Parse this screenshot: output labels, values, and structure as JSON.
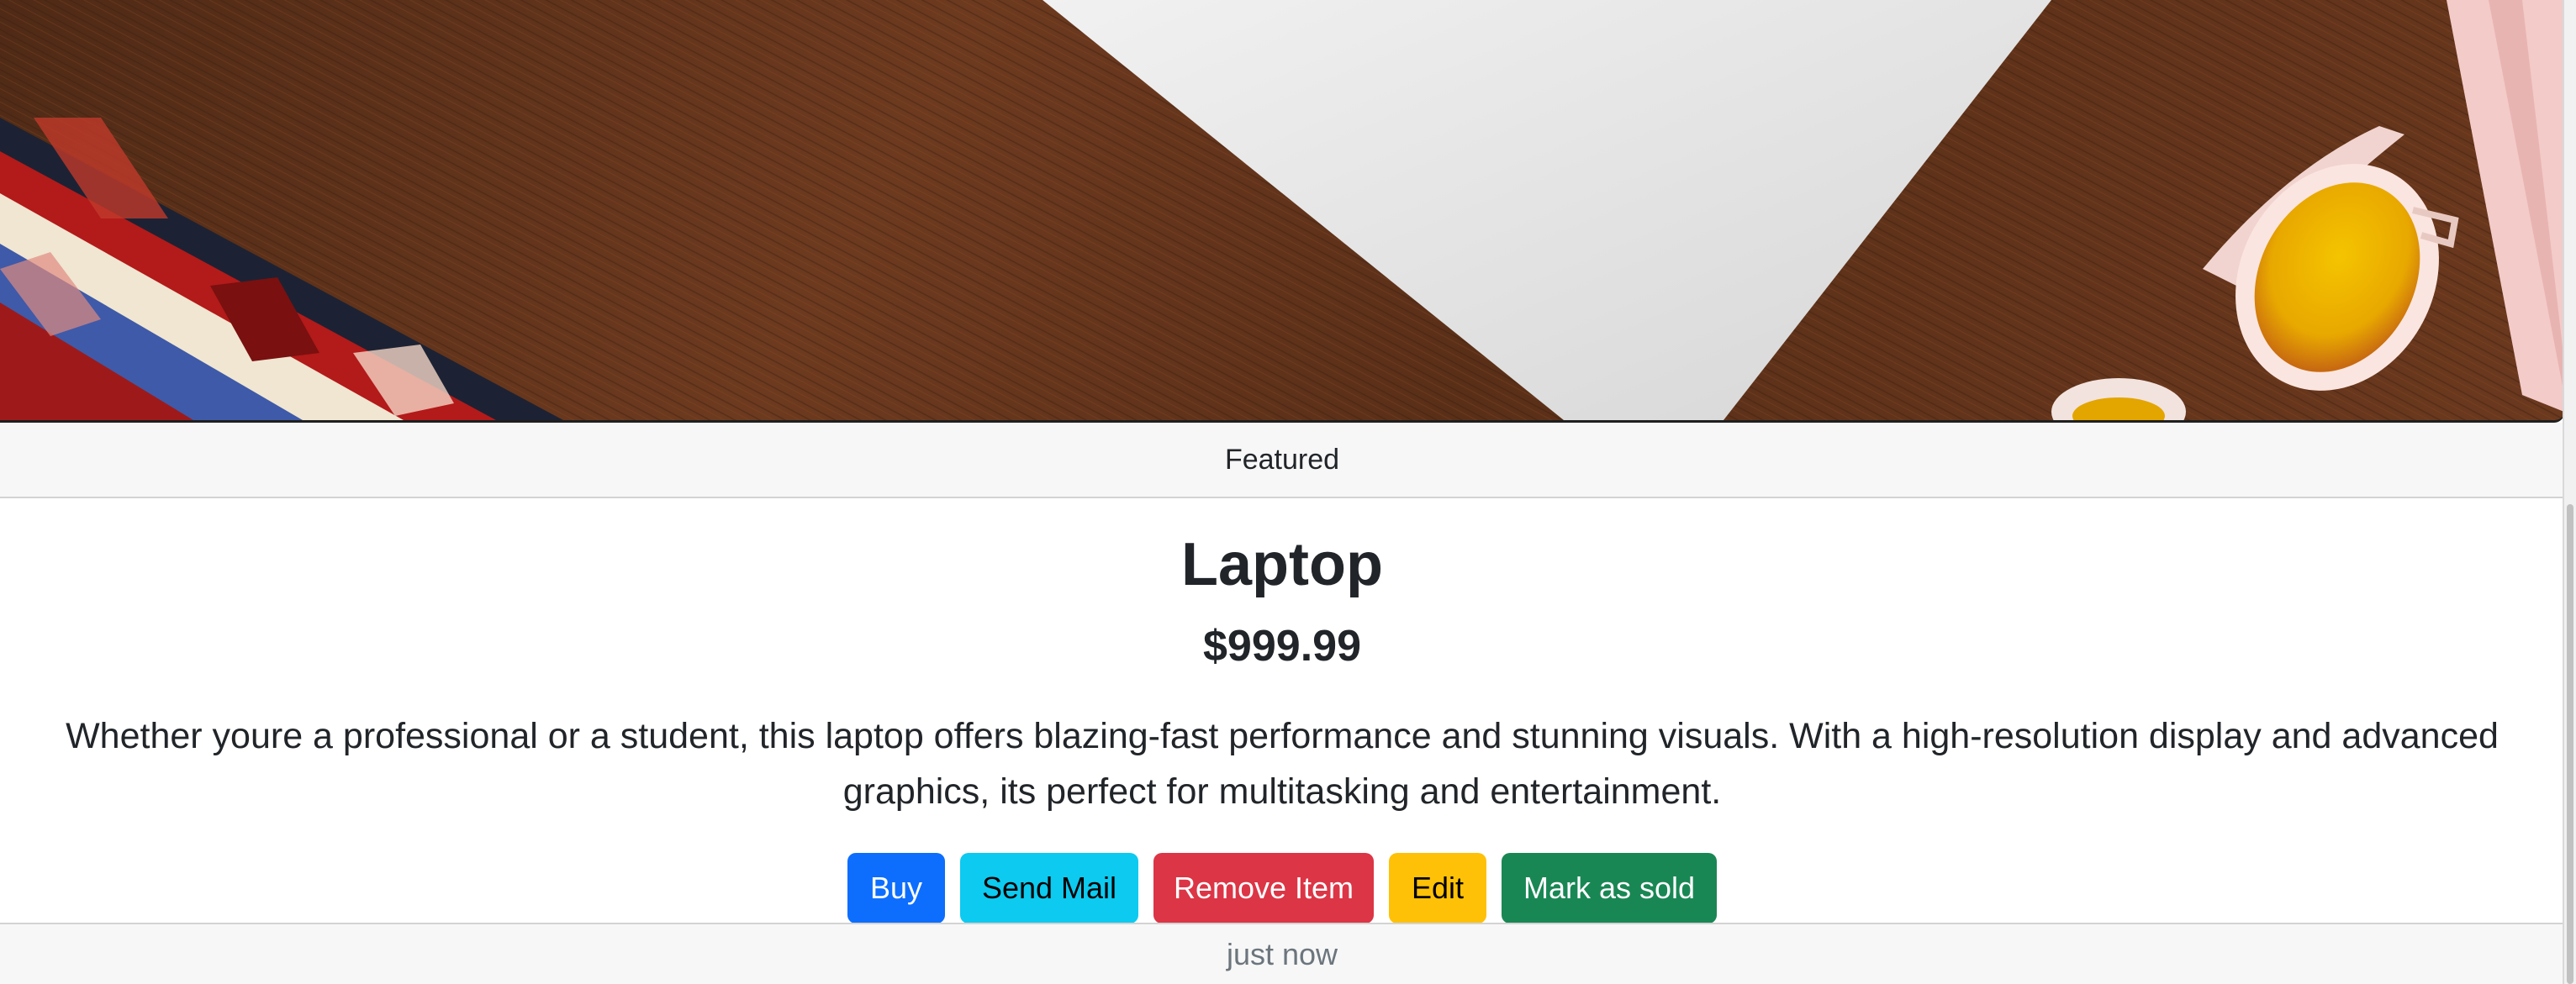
{
  "card": {
    "header": "Featured",
    "title": "Laptop",
    "price": "$999.99",
    "description": "Whether youre a professional or a student, this laptop offers blazing-fast performance and stunning visuals. With a high-resolution display and advanced graphics, its perfect for multitasking and entertainment.",
    "buttons": {
      "buy": "Buy",
      "send_mail": "Send Mail",
      "remove": "Remove Item",
      "edit": "Edit",
      "sold": "Mark as sold"
    },
    "footer": "just now"
  },
  "colors": {
    "buy": "#0d6efd",
    "send_mail": "#0dcaf0",
    "remove": "#dc3545",
    "edit": "#ffc107",
    "sold": "#198754",
    "wood": "#5a2f18"
  }
}
